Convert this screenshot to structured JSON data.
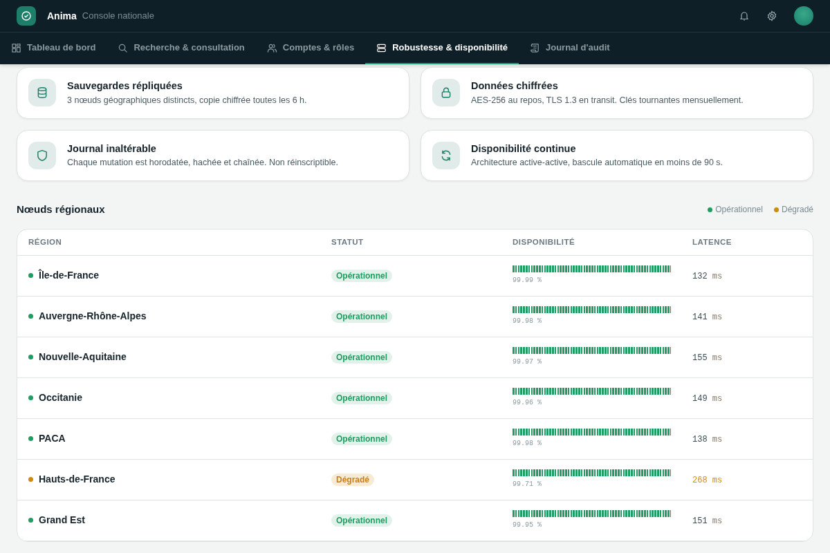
{
  "app": {
    "name": "Anima",
    "subtitle": "Console nationale"
  },
  "tabs": [
    {
      "label": "Tableau de bord",
      "kind": "grid",
      "selected": false
    },
    {
      "label": "Recherche & consultation",
      "kind": "search",
      "selected": false
    },
    {
      "label": "Comptes & rôles",
      "kind": "users",
      "selected": false
    },
    {
      "label": "Robustesse & disponibilité",
      "kind": "server",
      "selected": true
    },
    {
      "label": "Journal d'audit",
      "kind": "scroll",
      "selected": false
    }
  ],
  "features": [
    {
      "kind": "database",
      "title": "Sauvegardes répliquées",
      "text": "3 nœuds géographiques distincts, copie chiffrée toutes les 6 h."
    },
    {
      "kind": "lock",
      "title": "Données chiffrées",
      "text": "AES-256 au repos, TLS 1.3 en transit. Clés tournantes mensuellement."
    },
    {
      "kind": "shield",
      "title": "Journal inaltérable",
      "text": "Chaque mutation est horodatée, hachée et chaînée. Non réinscriptible."
    },
    {
      "kind": "refresh",
      "title": "Disponibilité continue",
      "text": "Architecture active-active, bascule automatique en moins de 90 s."
    }
  ],
  "nodes": {
    "title": "Nœuds régionaux",
    "legend": [
      {
        "label": "Opérationnel",
        "color": "#1f9d62"
      },
      {
        "label": "Dégradé",
        "color": "#d08a12"
      }
    ],
    "columns": [
      "RÉGION",
      "STATUT",
      "DISPONIBILITÉ",
      "LATENCE"
    ],
    "rows": [
      {
        "region": "Île-de-France",
        "status": "Opérationnel",
        "kind": "ok",
        "color": "#1f9d62",
        "uptime": "99.99 %",
        "latency": "132",
        "unit": "ms"
      },
      {
        "region": "Auvergne-Rhône-Alpes",
        "status": "Opérationnel",
        "kind": "ok",
        "color": "#1f9d62",
        "uptime": "99.98 %",
        "latency": "141",
        "unit": "ms"
      },
      {
        "region": "Nouvelle-Aquitaine",
        "status": "Opérationnel",
        "kind": "ok",
        "color": "#1f9d62",
        "uptime": "99.97 %",
        "latency": "155",
        "unit": "ms"
      },
      {
        "region": "Occitanie",
        "status": "Opérationnel",
        "kind": "ok",
        "color": "#1f9d62",
        "uptime": "99.96 %",
        "latency": "149",
        "unit": "ms"
      },
      {
        "region": "PACA",
        "status": "Opérationnel",
        "kind": "ok",
        "color": "#1f9d62",
        "uptime": "99.98 %",
        "latency": "138",
        "unit": "ms"
      },
      {
        "region": "Hauts-de-France",
        "status": "Dégradé",
        "kind": "degraded",
        "color": "#d08a12",
        "uptime": "99.71 %",
        "latency": "268",
        "unit": "ms"
      },
      {
        "region": "Grand Est",
        "status": "Opérationnel",
        "kind": "ok",
        "color": "#1f9d62",
        "uptime": "99.95 %",
        "latency": "151",
        "unit": "ms"
      }
    ]
  }
}
